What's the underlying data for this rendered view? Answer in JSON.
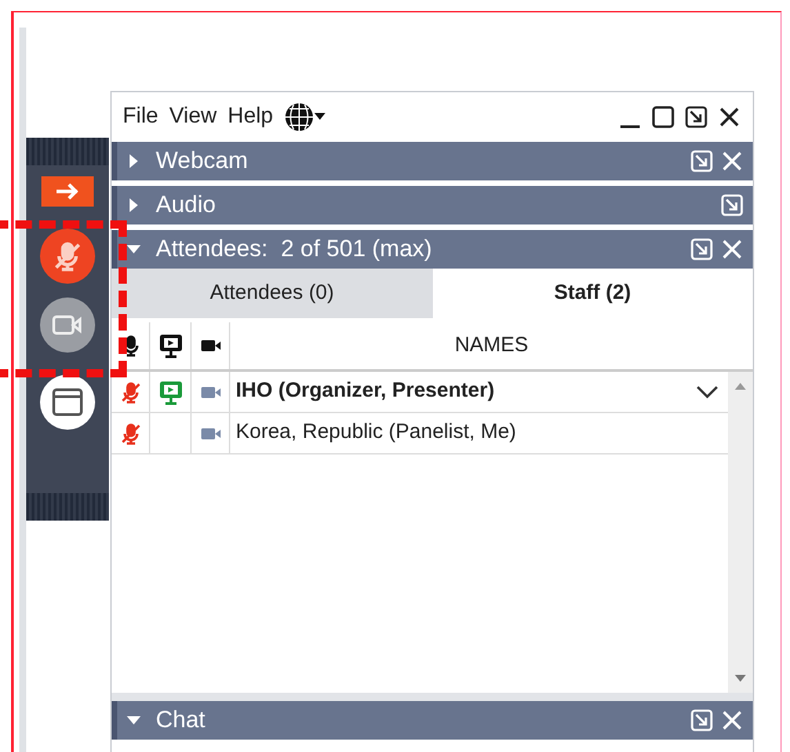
{
  "menu": [
    "File",
    "View",
    "Help"
  ],
  "panels": [
    {
      "title": "Webcam",
      "expanded": false,
      "closable": true
    },
    {
      "title": "Audio",
      "expanded": false,
      "closable": false
    },
    {
      "title": "Attendees:  2 of 501 (max)",
      "expanded": true,
      "closable": true
    }
  ],
  "tabs": [
    {
      "label": "Attendees (0)",
      "selected": false
    },
    {
      "label": "Staff (2)",
      "selected": true
    }
  ],
  "table": {
    "name_column": "NAMES",
    "rows": [
      {
        "name": "IHO (Organizer, Presenter)",
        "presenter": true,
        "muted": true
      },
      {
        "name": "Korea, Republic (Panelist, Me)",
        "presenter": false,
        "muted": true
      }
    ]
  },
  "chat": {
    "title": "Chat",
    "expanded": true
  },
  "toolbar": {
    "muted": true,
    "video_on": false
  }
}
